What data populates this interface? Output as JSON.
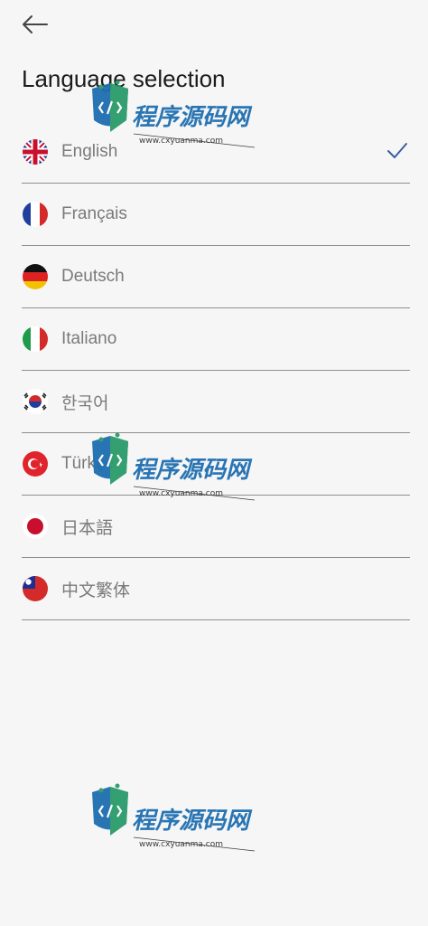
{
  "header": {
    "title": "Language selection"
  },
  "languages": [
    {
      "label": "English",
      "flag": "uk-flag-icon",
      "selected": true
    },
    {
      "label": "Français",
      "flag": "france-flag-icon",
      "selected": false
    },
    {
      "label": "Deutsch",
      "flag": "germany-flag-icon",
      "selected": false
    },
    {
      "label": "Italiano",
      "flag": "italy-flag-icon",
      "selected": false
    },
    {
      "label": "한국어",
      "flag": "south-korea-flag-icon",
      "selected": false
    },
    {
      "label": "Türkçe",
      "flag": "turkey-flag-icon",
      "selected": false
    },
    {
      "label": "日本語",
      "flag": "japan-flag-icon",
      "selected": false
    },
    {
      "label": "中文繁体",
      "flag": "taiwan-flag-icon",
      "selected": false
    }
  ],
  "watermark": {
    "text": "程序源码网",
    "url": "www.cxyuanma.com"
  },
  "colors": {
    "checkmark": "#3a5f9e",
    "divider": "#8f8f8f",
    "label": "#7a7a7a"
  }
}
